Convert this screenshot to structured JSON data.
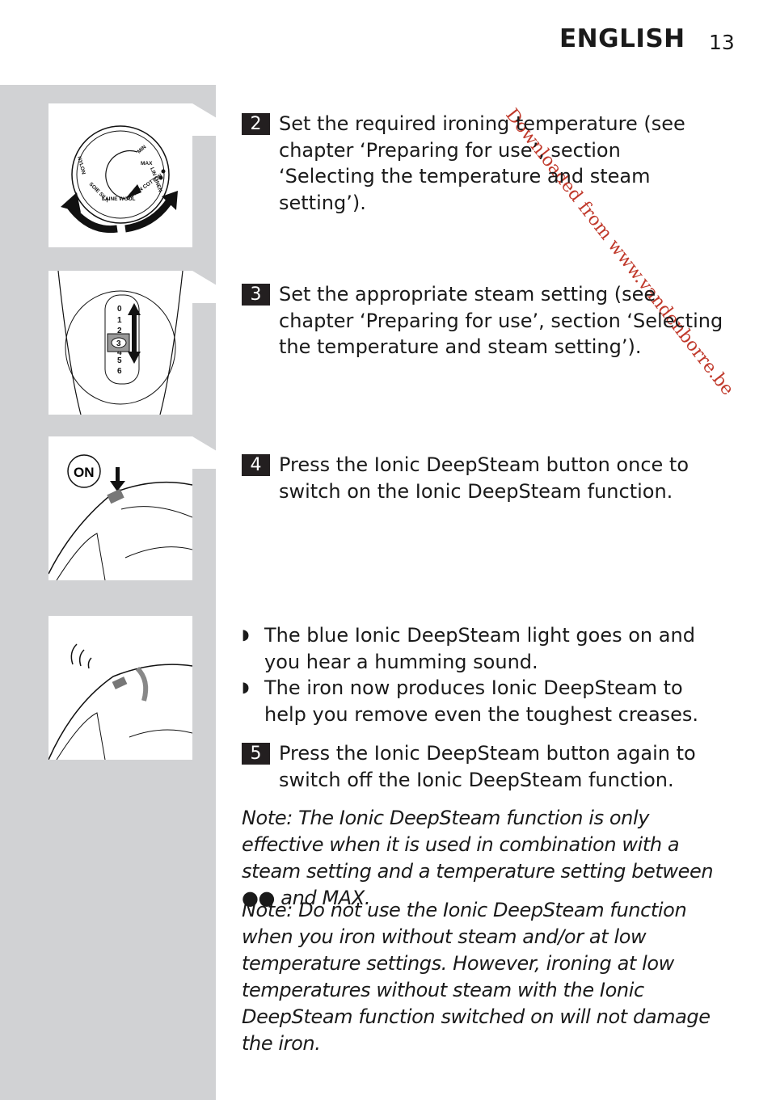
{
  "header": {
    "title": "ENGLISH",
    "page_number": "13"
  },
  "watermark": "Downloaded from www.vandenborre.be",
  "illustrations": [
    {
      "name": "temperature-dial",
      "labels": [
        "NYLON",
        "SOIE SILK",
        "LAINE WOOL",
        "COTON COTTON",
        "LIN LINEN",
        "MAX",
        "MIN"
      ]
    },
    {
      "name": "steam-setting-slider",
      "labels": [
        "0",
        "1",
        "2",
        "3",
        "4",
        "5",
        "6"
      ]
    },
    {
      "name": "ionic-button-on",
      "labels": [
        "ON"
      ]
    },
    {
      "name": "humming-iron",
      "labels": []
    }
  ],
  "steps": [
    {
      "number": "2",
      "text": "Set the required ironing temperature (see chapter ‘Preparing for use’, section ‘Selecting the temperature and steam setting’)."
    },
    {
      "number": "3",
      "text": "Set the appropriate steam setting (see chapter ‘Preparing for use’, section ‘Selecting the temperature and steam setting’)."
    },
    {
      "number": "4",
      "text": "Press the Ionic DeepSteam button once to switch on the Ionic DeepSteam function."
    },
    {
      "number": "5",
      "text": "Press the Ionic DeepSteam button again to switch off the Ionic DeepSteam function."
    }
  ],
  "bullets": [
    {
      "mark": "◗",
      "text": "The blue Ionic DeepSteam light goes on and you hear a humming sound."
    },
    {
      "mark": "◗",
      "text": "The iron now produces Ionic DeepSteam to help you remove even the toughest creases."
    }
  ],
  "notes": [
    "Note: The Ionic DeepSteam function is only effective when it is used in combination with a steam setting and a temperature setting between ●● and MAX.",
    "Note: Do not use the Ionic DeepSteam function when you iron without steam and/or at low temperature settings. However, ironing at low temperatures without steam with the Ionic DeepSteam function switched on will not damage the iron."
  ],
  "colors": {
    "band": "#d1d2d4",
    "number_box": "#231f20",
    "watermark": "#c0392b"
  }
}
